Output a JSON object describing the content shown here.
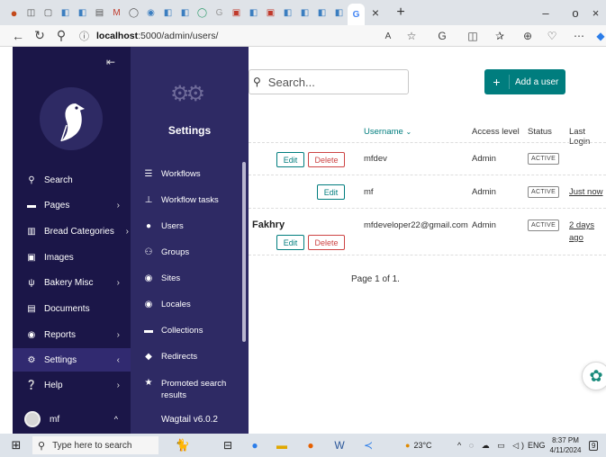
{
  "browser": {
    "tab_close": "×",
    "new_tab": "+",
    "minimize": "–",
    "restore": "o",
    "close": "×",
    "url_host": "localhost",
    "url_path": ":5000/admin/users/"
  },
  "search": {
    "placeholder": "Search..."
  },
  "add_user": {
    "plus": "+",
    "label": "Add a user"
  },
  "table": {
    "headers": {
      "username": "Username",
      "access": "Access level",
      "status": "Status",
      "last_login": "Last Login"
    },
    "rows": [
      {
        "name": "",
        "username": "mfdev",
        "access": "Admin",
        "status": "ACTIVE",
        "last_login": "",
        "edit": "Edit",
        "delete": "Delete"
      },
      {
        "name": "",
        "username": "mf",
        "access": "Admin",
        "status": "ACTIVE",
        "last_login": "Just now",
        "edit": "Edit"
      },
      {
        "name": "Fakhry",
        "username": "mfdeveloper22@gmail.com",
        "access": "Admin",
        "status": "ACTIVE",
        "last_login_1": "2 days",
        "last_login_2": "ago",
        "edit": "Edit",
        "delete": "Delete"
      }
    ],
    "pager": "Page 1 of 1."
  },
  "sidebar": {
    "items": [
      {
        "label": "Search"
      },
      {
        "label": "Pages",
        "chevron": "›"
      },
      {
        "label": "Bread Categories",
        "chevron": "›"
      },
      {
        "label": "Images"
      },
      {
        "label": "Bakery Misc",
        "chevron": "›"
      },
      {
        "label": "Documents"
      },
      {
        "label": "Reports",
        "chevron": "›"
      },
      {
        "label": "Settings",
        "chevron": "‹"
      },
      {
        "label": "Help",
        "chevron": "›"
      }
    ],
    "account": {
      "name": "mf",
      "chevron": "^"
    }
  },
  "settings_panel": {
    "title": "Settings",
    "items": [
      {
        "label": "Workflows"
      },
      {
        "label": "Workflow tasks"
      },
      {
        "label": "Users"
      },
      {
        "label": "Groups"
      },
      {
        "label": "Sites"
      },
      {
        "label": "Locales"
      },
      {
        "label": "Collections"
      },
      {
        "label": "Redirects"
      },
      {
        "label_1": "Promoted search",
        "label_2": "results"
      }
    ],
    "version": "Wagtail v6.0.2"
  },
  "taskbar": {
    "search_placeholder": "Type here to search",
    "weather": "23°C",
    "lang": "ENG",
    "time": "8:37 PM",
    "date": "4/11/2024",
    "notif": "9"
  },
  "colors": {
    "sidebar": "#1b1648",
    "submenu": "#2e2a64",
    "accent": "#007d7e",
    "danger": "#cd4444"
  }
}
